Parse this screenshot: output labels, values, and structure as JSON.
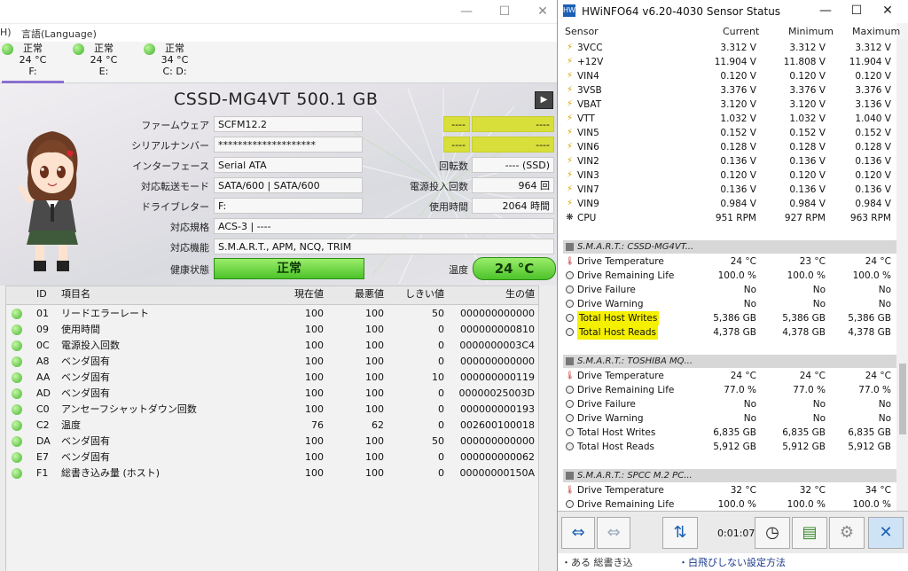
{
  "cdi": {
    "menu": {
      "lang": "言語(Language)",
      "frag": "H)"
    },
    "drives": [
      {
        "status": "正常",
        "temp": "24 °C",
        "letter": "F:"
      },
      {
        "status": "正常",
        "temp": "24 °C",
        "letter": "E:"
      },
      {
        "status": "正常",
        "temp": "34 °C",
        "letter": "C: D:"
      }
    ],
    "model": "CSSD-MG4VT 500.1 GB",
    "fields": {
      "firmware_label": "ファームウェア",
      "firmware": "SCFM12.2",
      "serial_label": "シリアルナンバー",
      "serial": "********************",
      "interface_label": "インターフェース",
      "interface": "Serial ATA",
      "transfer_label": "対応転送モード",
      "transfer": "SATA/600 | SATA/600",
      "drive_letter_label": "ドライブレター",
      "drive_letter": "F:",
      "standard_label": "対応規格",
      "standard": "ACS-3 | ----",
      "features_label": "対応機能",
      "features": "S.M.A.R.T., APM, NCQ, TRIM",
      "health_label": "健康状態",
      "health": "正常",
      "right_blank1": "----",
      "right_blank1b": "----",
      "right_blank2": "----",
      "right_blank2b": "----",
      "rotation_label": "回転数",
      "rotation": "---- (SSD)",
      "power_count_label": "電源投入回数",
      "power_count": "964 回",
      "hours_label": "使用時間",
      "hours": "2064 時間",
      "temp_label": "温度",
      "temp": "24 °C"
    },
    "smart_headers": {
      "id": "ID",
      "name": "項目名",
      "cur": "現在値",
      "wor": "最悪値",
      "thr": "しきい値",
      "raw": "生の値"
    },
    "smart_rows": [
      {
        "id": "01",
        "name": "リードエラーレート",
        "cur": "100",
        "wor": "100",
        "thr": "50",
        "raw": "000000000000"
      },
      {
        "id": "09",
        "name": "使用時間",
        "cur": "100",
        "wor": "100",
        "thr": "0",
        "raw": "000000000810"
      },
      {
        "id": "0C",
        "name": "電源投入回数",
        "cur": "100",
        "wor": "100",
        "thr": "0",
        "raw": "0000000003C4"
      },
      {
        "id": "A8",
        "name": "ベンダ固有",
        "cur": "100",
        "wor": "100",
        "thr": "0",
        "raw": "000000000000"
      },
      {
        "id": "AA",
        "name": "ベンダ固有",
        "cur": "100",
        "wor": "100",
        "thr": "10",
        "raw": "000000000119"
      },
      {
        "id": "AD",
        "name": "ベンダ固有",
        "cur": "100",
        "wor": "100",
        "thr": "0",
        "raw": "00000025003D"
      },
      {
        "id": "C0",
        "name": "アンセーフシャットダウン回数",
        "cur": "100",
        "wor": "100",
        "thr": "0",
        "raw": "000000000193"
      },
      {
        "id": "C2",
        "name": "温度",
        "cur": "76",
        "wor": "62",
        "thr": "0",
        "raw": "002600100018"
      },
      {
        "id": "DA",
        "name": "ベンダ固有",
        "cur": "100",
        "wor": "100",
        "thr": "50",
        "raw": "000000000000"
      },
      {
        "id": "E7",
        "name": "ベンダ固有",
        "cur": "100",
        "wor": "100",
        "thr": "0",
        "raw": "000000000062"
      },
      {
        "id": "F1",
        "name": "総書き込み量 (ホスト)",
        "cur": "100",
        "wor": "100",
        "thr": "0",
        "raw": "00000000150A"
      }
    ]
  },
  "hw": {
    "title": "HWiNFO64 v6.20-4030 Sensor Status",
    "headers": {
      "sensor": "Sensor",
      "current": "Current",
      "minimum": "Minimum",
      "maximum": "Maximum"
    },
    "rows": [
      {
        "kind": "volt",
        "name": "3VCC",
        "cur": "3.312 V",
        "min": "3.312 V",
        "max": "3.312 V"
      },
      {
        "kind": "volt",
        "name": "+12V",
        "cur": "11.904 V",
        "min": "11.808 V",
        "max": "11.904 V"
      },
      {
        "kind": "volt",
        "name": "VIN4",
        "cur": "0.120 V",
        "min": "0.120 V",
        "max": "0.120 V"
      },
      {
        "kind": "volt",
        "name": "3VSB",
        "cur": "3.376 V",
        "min": "3.376 V",
        "max": "3.376 V"
      },
      {
        "kind": "volt",
        "name": "VBAT",
        "cur": "3.120 V",
        "min": "3.120 V",
        "max": "3.136 V"
      },
      {
        "kind": "volt",
        "name": "VTT",
        "cur": "1.032 V",
        "min": "1.032 V",
        "max": "1.040 V"
      },
      {
        "kind": "volt",
        "name": "VIN5",
        "cur": "0.152 V",
        "min": "0.152 V",
        "max": "0.152 V"
      },
      {
        "kind": "volt",
        "name": "VIN6",
        "cur": "0.128 V",
        "min": "0.128 V",
        "max": "0.128 V"
      },
      {
        "kind": "volt",
        "name": "VIN2",
        "cur": "0.136 V",
        "min": "0.136 V",
        "max": "0.136 V"
      },
      {
        "kind": "volt",
        "name": "VIN3",
        "cur": "0.120 V",
        "min": "0.120 V",
        "max": "0.120 V"
      },
      {
        "kind": "volt",
        "name": "VIN7",
        "cur": "0.136 V",
        "min": "0.136 V",
        "max": "0.136 V"
      },
      {
        "kind": "volt",
        "name": "VIN9",
        "cur": "0.984 V",
        "min": "0.984 V",
        "max": "0.984 V"
      },
      {
        "kind": "fan",
        "name": "CPU",
        "cur": "951 RPM",
        "min": "927 RPM",
        "max": "963 RPM"
      },
      {
        "kind": "blank"
      },
      {
        "kind": "section",
        "name": "S.M.A.R.T.: CSSD-MG4VT..."
      },
      {
        "kind": "therm",
        "name": "Drive Temperature",
        "cur": "24 °C",
        "min": "23 °C",
        "max": "24 °C"
      },
      {
        "kind": "gauge",
        "name": "Drive Remaining Life",
        "cur": "100.0 %",
        "min": "100.0 %",
        "max": "100.0 %"
      },
      {
        "kind": "gauge",
        "name": "Drive Failure",
        "cur": "No",
        "min": "No",
        "max": "No"
      },
      {
        "kind": "gauge",
        "name": "Drive Warning",
        "cur": "No",
        "min": "No",
        "max": "No"
      },
      {
        "kind": "gauge",
        "name": "Total Host Writes",
        "cur": "5,386 GB",
        "min": "5,386 GB",
        "max": "5,386 GB",
        "hl": true
      },
      {
        "kind": "gauge",
        "name": "Total Host Reads",
        "cur": "4,378 GB",
        "min": "4,378 GB",
        "max": "4,378 GB",
        "hl": true
      },
      {
        "kind": "blank"
      },
      {
        "kind": "section",
        "name": "S.M.A.R.T.: TOSHIBA MQ..."
      },
      {
        "kind": "therm",
        "name": "Drive Temperature",
        "cur": "24 °C",
        "min": "24 °C",
        "max": "24 °C"
      },
      {
        "kind": "gauge",
        "name": "Drive Remaining Life",
        "cur": "77.0 %",
        "min": "77.0 %",
        "max": "77.0 %"
      },
      {
        "kind": "gauge",
        "name": "Drive Failure",
        "cur": "No",
        "min": "No",
        "max": "No"
      },
      {
        "kind": "gauge",
        "name": "Drive Warning",
        "cur": "No",
        "min": "No",
        "max": "No"
      },
      {
        "kind": "gauge",
        "name": "Total Host Writes",
        "cur": "6,835 GB",
        "min": "6,835 GB",
        "max": "6,835 GB"
      },
      {
        "kind": "gauge",
        "name": "Total Host Reads",
        "cur": "5,912 GB",
        "min": "5,912 GB",
        "max": "5,912 GB"
      },
      {
        "kind": "blank"
      },
      {
        "kind": "section",
        "name": "S.M.A.R.T.: SPCC M.2 PC..."
      },
      {
        "kind": "therm",
        "name": "Drive Temperature",
        "cur": "32 °C",
        "min": "32 °C",
        "max": "34 °C"
      },
      {
        "kind": "gauge",
        "name": "Drive Remaining Life",
        "cur": "100.0 %",
        "min": "100.0 %",
        "max": "100.0 %"
      }
    ],
    "timer": "0:01:07",
    "bottom_left": "・ある 総書き込",
    "bottom_right": "・白飛びしない設定方法"
  }
}
